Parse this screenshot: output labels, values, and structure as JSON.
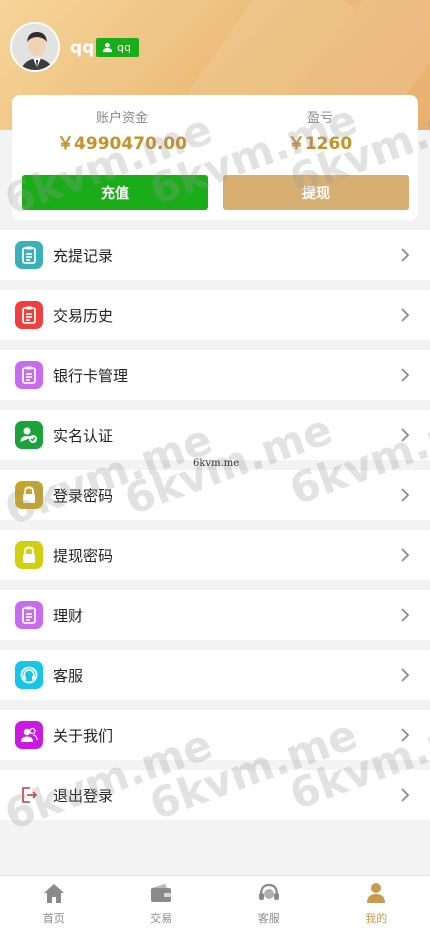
{
  "profile": {
    "username": "qq",
    "badge_label": "qq"
  },
  "account": {
    "balance_label": "账户资金",
    "balance_value": "￥4990470.00",
    "profit_label": "盈亏",
    "profit_value": "￥1260",
    "recharge_label": "充值",
    "withdraw_label": "提现"
  },
  "menu": {
    "items": [
      {
        "label": "充提记录",
        "icon": "document-icon",
        "color": "#3ab1b9"
      },
      {
        "label": "交易历史",
        "icon": "document-icon",
        "color": "#ef4040"
      },
      {
        "label": "银行卡管理",
        "icon": "document-icon",
        "color": "#c86bf0"
      },
      {
        "label": "实名认证",
        "icon": "user-check-icon",
        "color": "#19a33a"
      },
      {
        "label": "登录密码",
        "icon": "lock-icon",
        "color": "#c9a426"
      },
      {
        "label": "提现密码",
        "icon": "lock-icon",
        "color": "#d2cf13"
      },
      {
        "label": "理财",
        "icon": "document-icon",
        "color": "#c86bf0"
      },
      {
        "label": "客服",
        "icon": "headset-icon",
        "color": "#16c5e8"
      },
      {
        "label": "关于我们",
        "icon": "users-icon",
        "color": "#cc19e0"
      },
      {
        "label": "退出登录",
        "icon": "logout-icon",
        "color": "#c43b3b"
      }
    ]
  },
  "tabbar": {
    "tabs": [
      {
        "label": "首页",
        "icon": "home-icon"
      },
      {
        "label": "交易",
        "icon": "wallet-icon"
      },
      {
        "label": "客服",
        "icon": "headset-icon"
      },
      {
        "label": "我的",
        "icon": "person-icon"
      }
    ],
    "active_color": "#c89b53"
  },
  "watermark": {
    "text": "6kvm.me",
    "small_text": "6kvm.me"
  }
}
